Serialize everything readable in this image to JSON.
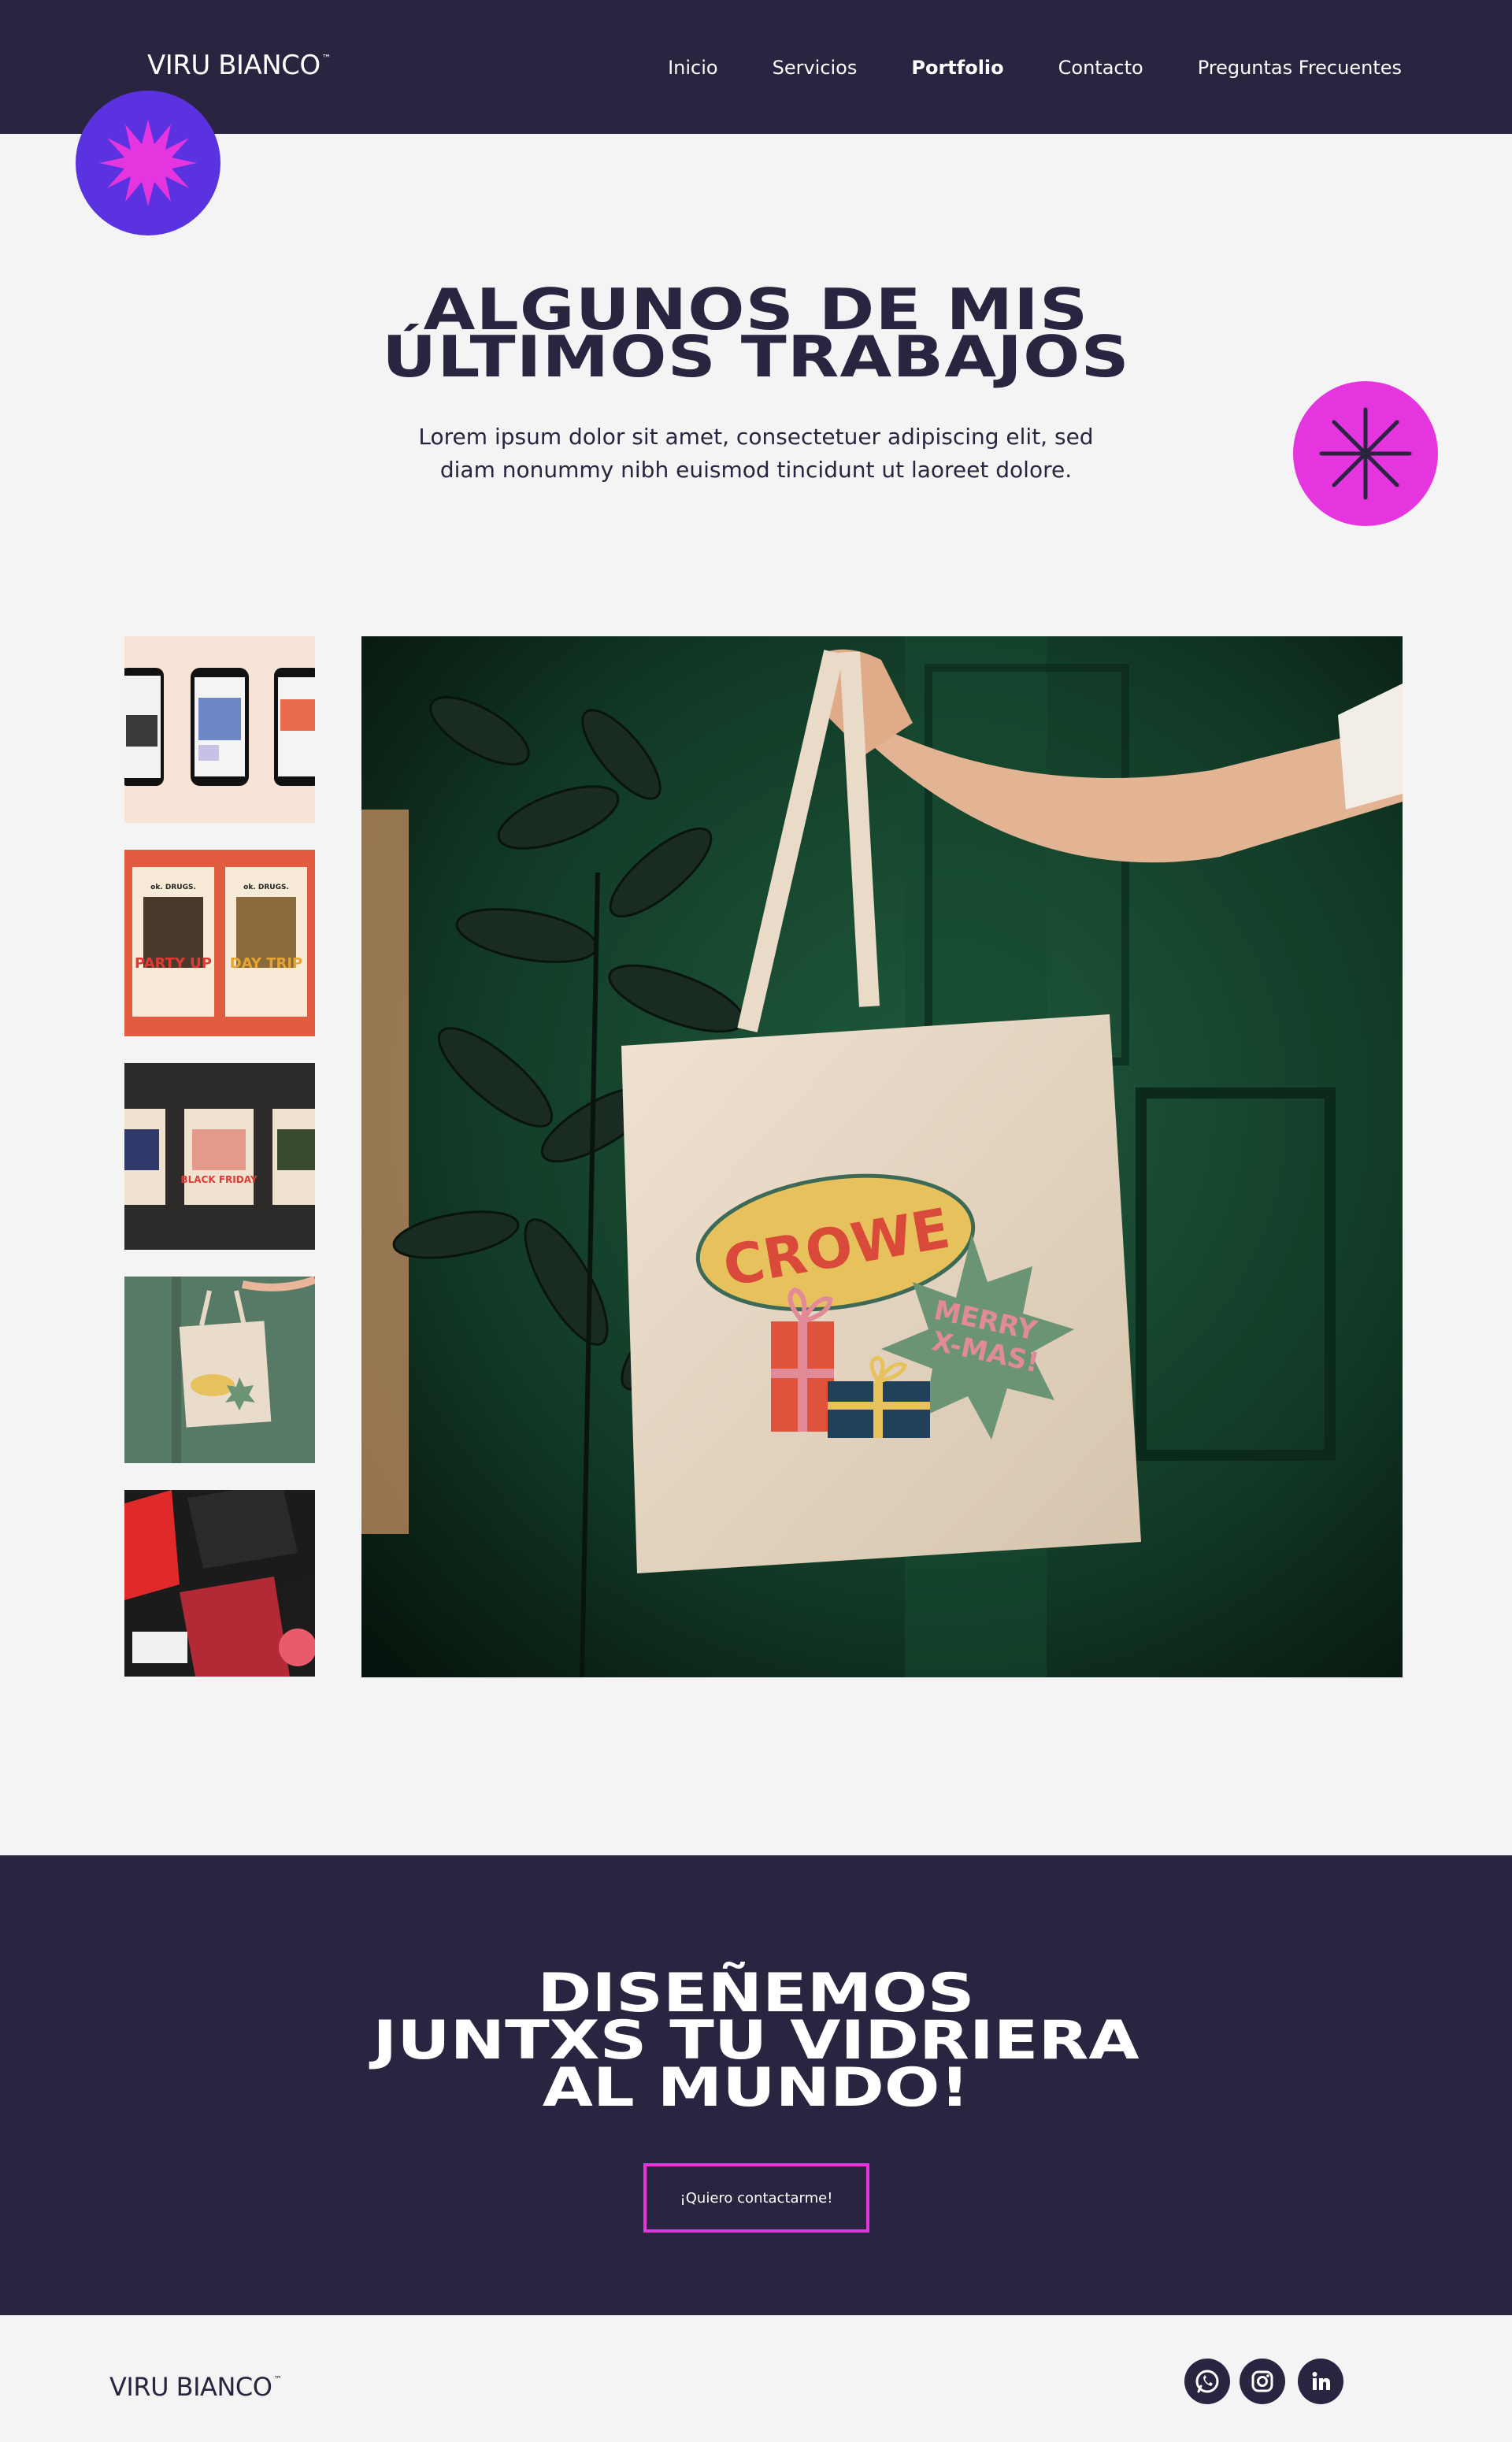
{
  "header": {
    "logo": "VIRU BIANCO",
    "logo_mark": "™",
    "nav": [
      {
        "label": "Inicio",
        "active": false
      },
      {
        "label": "Servicios",
        "active": false
      },
      {
        "label": "Portfolio",
        "active": true
      },
      {
        "label": "Contacto",
        "active": false
      },
      {
        "label": "Preguntas Frecuentes",
        "active": false
      }
    ]
  },
  "hero": {
    "title_line1": "ALGUNOS DE MIS",
    "title_line2": "ÚLTIMOS TRABAJOS",
    "subtitle_line1": "Lorem ipsum dolor sit amet, consectetuer adipiscing elit, sed",
    "subtitle_line2": "diam nonummy nibh euismod tincidunt ut laoreet dolore."
  },
  "gallery": {
    "thumbnails": [
      {
        "name": "instagram-phones-mockup",
        "selected": false
      },
      {
        "name": "party-poster-mockup",
        "selected": false
      },
      {
        "name": "posters-dark-mockup",
        "selected": false
      },
      {
        "name": "tote-bag-mockup",
        "selected": true
      },
      {
        "name": "social-media-red-mockup",
        "selected": false
      }
    ],
    "main_image": {
      "bag_brand": "CROWE",
      "bag_badge_line1": "MERRY",
      "bag_badge_line2": "X-MAS!"
    },
    "thumb_texts": {
      "party_up": "PARTY UP",
      "day_trip": "DAY TRIP",
      "ok_drugs": "ok. DRUGS.",
      "black_friday": "BLACK FRIDAY"
    }
  },
  "cta": {
    "line1": "DISEÑEMOS",
    "line2": "JUNTXS TU VIDRIERA",
    "line3": "AL MUNDO!",
    "button": "¡Quiero contactarme!"
  },
  "footer": {
    "logo": "VIRU BIANCO",
    "logo_mark": "™",
    "socials": [
      "whatsapp-icon",
      "instagram-icon",
      "linkedin-icon"
    ]
  },
  "colors": {
    "navy": "#29243f",
    "purple": "#5b32e0",
    "magenta": "#e535de",
    "background": "#f4f4f4"
  }
}
